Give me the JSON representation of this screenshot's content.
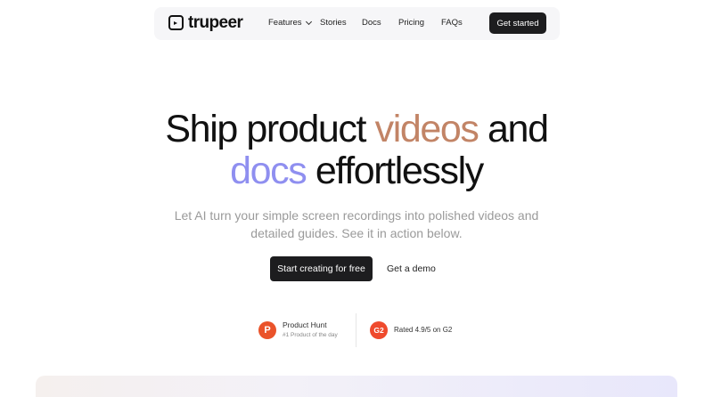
{
  "nav": {
    "logo_text": "trupeer",
    "items": [
      {
        "label": "Features"
      },
      {
        "label": "Stories"
      },
      {
        "label": "Docs"
      },
      {
        "label": "Pricing"
      },
      {
        "label": "FAQs"
      }
    ],
    "cta_label": "Get started"
  },
  "hero": {
    "headline": {
      "part1": "Ship product ",
      "highlight1": "videos",
      "part2": " and",
      "highlight2": "docs",
      "part3": " effortlessly"
    },
    "subtitle_line1": "Let AI turn your simple screen recordings into polished videos and",
    "subtitle_line2": "detailed guides. See it in action below.",
    "primary_cta": "Start creating for free",
    "secondary_cta": "Get a demo"
  },
  "badges": {
    "product_hunt": {
      "icon_letter": "P",
      "title": "Product Hunt",
      "subtitle": "#1 Product of the day"
    },
    "g2": {
      "icon_text": "G2",
      "text": "Rated 4.9/5 on G2"
    }
  },
  "colors": {
    "accent_videos": "#c28466",
    "accent_docs": "#8f8ff0",
    "button_dark": "#1d1d1f",
    "product_hunt": "#ea532a",
    "g2": "#ef4a2d"
  },
  "icons": [
    "logo-mark-icon",
    "chevron-down-icon",
    "product-hunt-icon",
    "g2-icon"
  ]
}
